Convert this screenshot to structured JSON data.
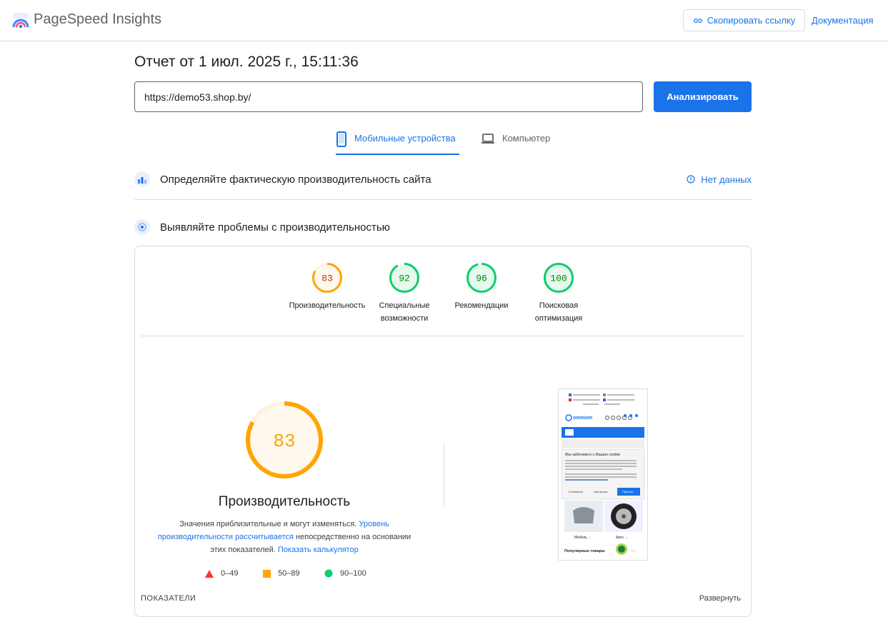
{
  "header": {
    "app_title": "PageSpeed Insights",
    "copy_link_label": "Скопировать ссылку",
    "docs_label": "Документация"
  },
  "report": {
    "title": "Отчет от 1 июл. 2025 г., 15:11:36",
    "url_value": "https://demo53.shop.by/",
    "analyze_label": "Анализировать"
  },
  "tabs": [
    {
      "label": "Мобильные устройства",
      "active": true
    },
    {
      "label": "Компьютер",
      "active": false
    }
  ],
  "field_data": {
    "title": "Определяйте фактическую производительность сайта",
    "status": "Нет данных"
  },
  "lab_data": {
    "title": "Выявляйте проблемы с производительностью"
  },
  "scores": [
    {
      "value": "83",
      "label_line1": "Производительность",
      "label_line2": "",
      "color": "#ffa400"
    },
    {
      "value": "92",
      "label_line1": "Специальные",
      "label_line2": "возможности",
      "color": "#0cce6b"
    },
    {
      "value": "96",
      "label_line1": "Рекомендации",
      "label_line2": "",
      "color": "#0cce6b"
    },
    {
      "value": "100",
      "label_line1": "Поисковая",
      "label_line2": "оптимизация",
      "color": "#0cce6b"
    }
  ],
  "performance": {
    "score": "83",
    "title": "Производительность",
    "desc_part1": "Значения приблизительные и могут изменяться. ",
    "desc_link1": "Уровень производительности рассчитывается",
    "desc_part2": " непосредственно на основании этих показателей. ",
    "desc_link2": "Показать калькулятор",
    "legend": [
      {
        "range": "0–49",
        "color": "#ff3333"
      },
      {
        "range": "50–89",
        "color": "#ffa400"
      },
      {
        "range": "90–100",
        "color": "#0cce6b"
      }
    ]
  },
  "preview": {
    "cookie_title": "Мы заботимся о Ваших cookie",
    "cookie_btn_decline": "Отключить",
    "cookie_btn_settings": "Настроить",
    "cookie_btn_accept": "Принять",
    "brand": "omniom",
    "category1": "Мебель →",
    "category2": "Авто →",
    "popular": "Популярные товары"
  },
  "metrics": {
    "label": "ПОКАЗАТЕЛИ",
    "expand_label": "Развернуть"
  }
}
